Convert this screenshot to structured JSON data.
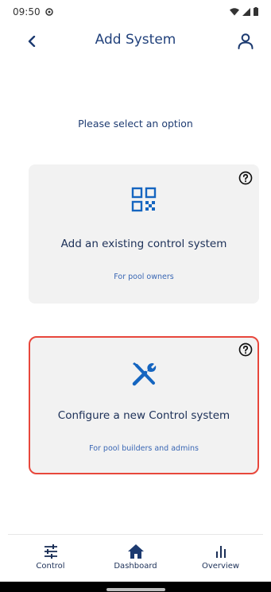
{
  "status_bar": {
    "time": "09:50",
    "icons": [
      "settings-icon",
      "wifi-icon",
      "signal-icon",
      "battery-icon"
    ]
  },
  "header": {
    "title": "Add System",
    "back_icon": "chevron-left-icon",
    "profile_icon": "person-icon"
  },
  "main": {
    "prompt": "Please select an option",
    "cards": [
      {
        "title": "Add an existing control system",
        "subtitle": "For pool owners",
        "icon": "qr-code-icon",
        "help_icon": "help-icon",
        "highlighted": false
      },
      {
        "title": "Configure a new Control system",
        "subtitle": "For pool builders and admins",
        "icon": "tools-icon",
        "help_icon": "help-icon",
        "highlighted": true
      }
    ]
  },
  "bottom_nav": {
    "items": [
      {
        "label": "Control",
        "icon": "sliders-icon"
      },
      {
        "label": "Dashboard",
        "icon": "home-icon"
      },
      {
        "label": "Overview",
        "icon": "bar-chart-icon"
      }
    ]
  },
  "colors": {
    "primary": "#1c3a70",
    "accent_blue": "#1565c0",
    "card_bg": "#f2f2f2",
    "highlight_border": "#e8473c"
  }
}
